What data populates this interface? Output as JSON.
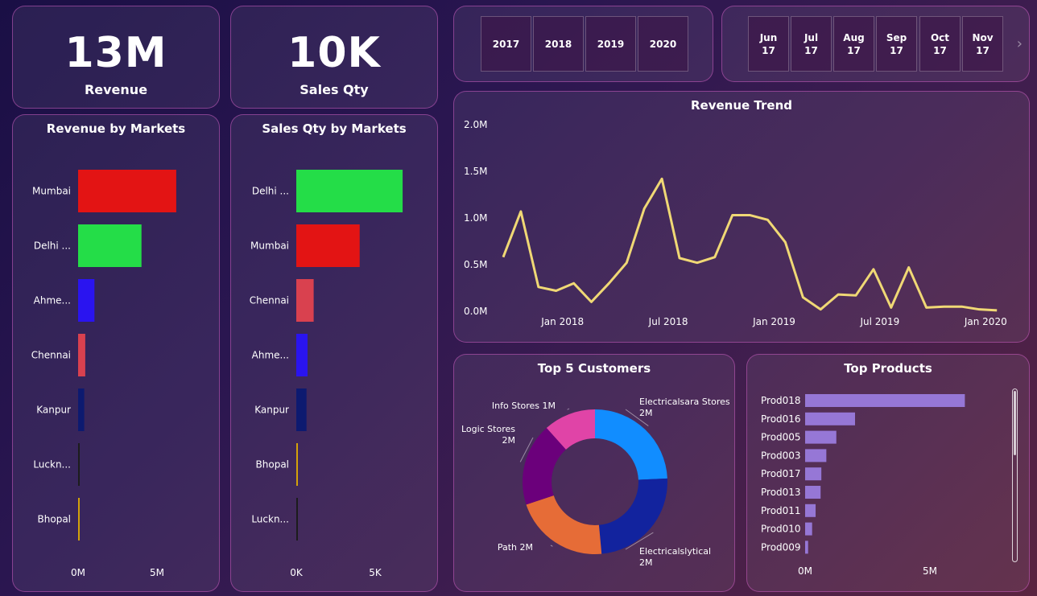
{
  "kpis": {
    "revenue": {
      "value": "13M",
      "label": "Revenue"
    },
    "sales_qty": {
      "value": "10K",
      "label": "Sales Qty"
    }
  },
  "year_slicer": [
    "2017",
    "2018",
    "2019",
    "2020"
  ],
  "month_slicer": [
    {
      "month": "Jun",
      "year": "17"
    },
    {
      "month": "Jul",
      "year": "17"
    },
    {
      "month": "Aug",
      "year": "17"
    },
    {
      "month": "Sep",
      "year": "17"
    },
    {
      "month": "Oct",
      "year": "17"
    },
    {
      "month": "Nov",
      "year": "17"
    }
  ],
  "month_slicer_next": "›",
  "colors": {
    "red": "#e31414",
    "green": "#24dd48",
    "blue": "#2a14f0",
    "rose": "#d9414f",
    "navy": "#0d1a70",
    "dark": "#1c1c1c",
    "gold": "#d4a20a",
    "line": "#f0d875",
    "purple_bar": "#9677d6"
  },
  "chart_data": [
    {
      "id": "revenue_by_markets",
      "type": "bar",
      "orientation": "horizontal",
      "title": "Revenue by Markets",
      "categories": [
        "Mumbai",
        "Delhi ...",
        "Ahme...",
        "Chennai",
        "Kanpur",
        "Luckn...",
        "Bhopal"
      ],
      "values": [
        4.8,
        3.1,
        0.8,
        0.35,
        0.3,
        0.05,
        0.06
      ],
      "colors": [
        "#e31414",
        "#24dd48",
        "#2a14f0",
        "#d9414f",
        "#0d1a70",
        "#1c1c1c",
        "#d4a20a"
      ],
      "xticks": [
        "0M",
        "5M"
      ],
      "xlim": [
        0,
        6
      ],
      "unit": "M"
    },
    {
      "id": "sales_qty_by_markets",
      "type": "bar",
      "orientation": "horizontal",
      "title": "Sales Qty by Markets",
      "categories": [
        "Delhi ...",
        "Mumbai",
        "Chennai",
        "Ahme...",
        "Kanpur",
        "Bhopal",
        "Luckn..."
      ],
      "values": [
        5200,
        3100,
        850,
        550,
        500,
        70,
        40
      ],
      "colors": [
        "#24dd48",
        "#e31414",
        "#d9414f",
        "#2a14f0",
        "#0d1a70",
        "#d4a20a",
        "#1c1c1c"
      ],
      "xticks": [
        "0K",
        "5K"
      ],
      "xlim": [
        0,
        6000
      ]
    },
    {
      "id": "revenue_trend",
      "type": "line",
      "title": "Revenue Trend",
      "x": [
        "2017-10",
        "2017-11",
        "2017-12",
        "2018-01",
        "2018-02",
        "2018-03",
        "2018-04",
        "2018-05",
        "2018-06",
        "2018-07",
        "2018-08",
        "2018-09",
        "2018-10",
        "2018-11",
        "2018-12",
        "2019-01",
        "2019-02",
        "2019-03",
        "2019-04",
        "2019-05",
        "2019-06",
        "2019-07",
        "2019-08",
        "2019-09",
        "2019-10",
        "2019-11",
        "2019-12",
        "2020-01",
        "2020-02"
      ],
      "values": [
        0.58,
        1.07,
        0.26,
        0.22,
        0.3,
        0.1,
        0.3,
        0.52,
        1.1,
        1.42,
        0.57,
        0.52,
        0.58,
        1.03,
        1.03,
        0.98,
        0.74,
        0.15,
        0.02,
        0.18,
        0.17,
        0.45,
        0.04,
        0.47,
        0.04,
        0.05,
        0.05,
        0.02,
        0.01
      ],
      "yticks": [
        "0.0M",
        "0.5M",
        "1.0M",
        "1.5M",
        "2.0M"
      ],
      "ylim": [
        0,
        2.0
      ],
      "xticks": [
        {
          "label": "Jan 2018",
          "date": "2018-01"
        },
        {
          "label": "Jul 2018",
          "date": "2018-07"
        },
        {
          "label": "Jan 2019",
          "date": "2019-01"
        },
        {
          "label": "Jul 2019",
          "date": "2019-07"
        },
        {
          "label": "Jan 2020",
          "date": "2020-01"
        }
      ],
      "color": "#f0d875"
    },
    {
      "id": "top_5_customers",
      "type": "pie",
      "donut": true,
      "title": "Top 5 Customers",
      "labels": [
        "Electricalsara Stores",
        "Electricalslytical",
        "Path",
        "Logic Stores",
        "Info Stores"
      ],
      "values": [
        2.5,
        2.5,
        2.2,
        1.9,
        1.2
      ],
      "value_labels": [
        "2M",
        "2M",
        "2M",
        "2M",
        "1M"
      ],
      "colors": [
        "#118dff",
        "#12239e",
        "#e66c37",
        "#6b007b",
        "#e044a7"
      ]
    },
    {
      "id": "top_products",
      "type": "bar",
      "orientation": "horizontal",
      "title": "Top Products",
      "categories": [
        "Prod018",
        "Prod016",
        "Prod005",
        "Prod003",
        "Prod017",
        "Prod013",
        "Prod011",
        "Prod010",
        "Prod009"
      ],
      "values": [
        6.4,
        2.0,
        1.25,
        0.85,
        0.65,
        0.62,
        0.42,
        0.28,
        0.12
      ],
      "xticks": [
        "0M",
        "5M"
      ],
      "xlim": [
        0,
        8.2
      ],
      "color": "#9677d6"
    }
  ]
}
